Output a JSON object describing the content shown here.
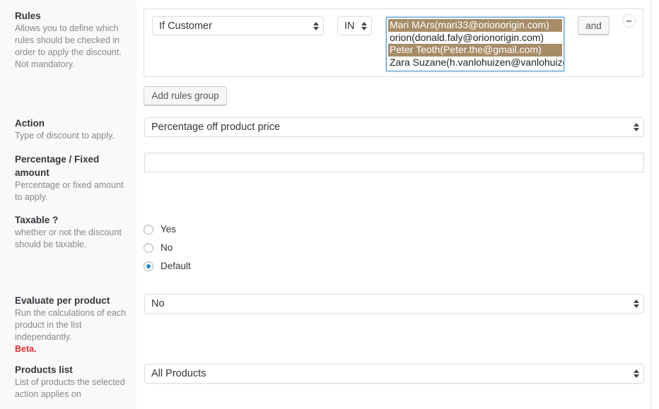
{
  "fields": {
    "rules": {
      "title": "Rules",
      "description": "Allows you to define which rules should be checked in order to apply the discount. Not mandatory.",
      "condition_select": "If Customer",
      "operator_select": "IN",
      "customers": [
        {
          "label": "Mari MArs(mari33@orionorigin.com)",
          "selected": true
        },
        {
          "label": "orion(donald.faly@orionorigin.com)",
          "selected": false
        },
        {
          "label": "Peter Teoth(Peter.the@gmail.com)",
          "selected": true
        },
        {
          "label": "Zara Suzane(h.vanlohuizen@vanlohuizen.com)",
          "selected": false
        }
      ],
      "and_button": "and",
      "remove_icon": "minus-circle-icon",
      "add_group_button": "Add rules group"
    },
    "action": {
      "title": "Action",
      "description": "Type of discount to apply.",
      "value": "Percentage off product price"
    },
    "amount": {
      "title": "Percentage / Fixed amount",
      "description": "Percentage or fixed amount to apply.",
      "value": ""
    },
    "taxable": {
      "title": "Taxable ?",
      "description": "whether or not the discount should be taxable.",
      "options": [
        {
          "label": "Yes",
          "checked": false
        },
        {
          "label": "No",
          "checked": false
        },
        {
          "label": "Default",
          "checked": true
        }
      ]
    },
    "evaluate": {
      "title": "Evaluate per product",
      "description": "Run the calculations of each product in the list independantly.",
      "badge": "Beta.",
      "value": "No"
    },
    "products": {
      "title": "Products list",
      "description": "List of products the selected action applies on",
      "value": "All Products"
    }
  },
  "colors": {
    "selected_option_bg": "#a78c68",
    "beta_red": "#dc3232",
    "radio_accent": "#1e8cbe"
  }
}
